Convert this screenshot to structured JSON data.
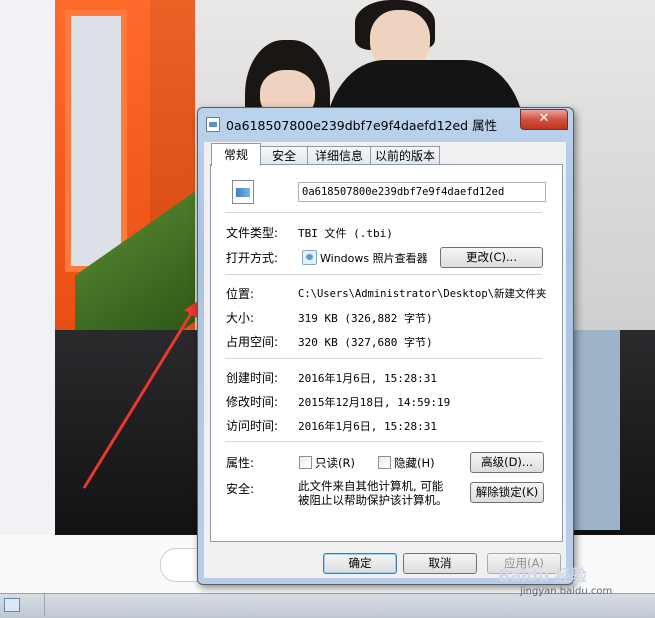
{
  "dialog": {
    "title": "0a618507800e239dbf7e9f4daefd12ed 属性",
    "close_label": "✕",
    "tabs": [
      {
        "label": "常规",
        "active": true
      },
      {
        "label": "安全",
        "active": false
      },
      {
        "label": "详细信息",
        "active": false
      },
      {
        "label": "以前的版本",
        "active": false
      }
    ],
    "filename": "0a618507800e239dbf7e9f4daefd12ed",
    "file_type_label": "文件类型:",
    "file_type_value": "TBI 文件 (.tbi)",
    "open_with_label": "打开方式:",
    "open_with_value": "Windows 照片查看器",
    "change_button": "更改(C)...",
    "location_label": "位置:",
    "location_value": "C:\\Users\\Administrator\\Desktop\\新建文件夹",
    "size_label": "大小:",
    "size_value": "319 KB (326,882 字节)",
    "size_on_disk_label": "占用空间:",
    "size_on_disk_value": "320 KB (327,680 字节)",
    "created_label": "创建时间:",
    "created_value": "2016年1月6日, 15:28:31",
    "modified_label": "修改时间:",
    "modified_value": "2015年12月18日, 14:59:19",
    "accessed_label": "访问时间:",
    "accessed_value": "2016年1月6日, 15:28:31",
    "attributes_label": "属性:",
    "readonly_label": "只读(R)",
    "hidden_label": "隐藏(H)",
    "advanced_button": "高级(D)...",
    "security_label": "安全:",
    "security_note_line1": "此文件来自其他计算机, 可能",
    "security_note_line2": "被阻止以帮助保护该计算机。",
    "unblock_button": "解除锁定(K)",
    "ok_button": "确定",
    "cancel_button": "取消",
    "apply_button": "应用(A)"
  },
  "watermark": {
    "brand": "Baidu 经验",
    "url": "jingyan.baidu.com"
  },
  "colors": {
    "arrow": "#e8392b",
    "door": "#f2571b",
    "close_button": "#c84430"
  }
}
